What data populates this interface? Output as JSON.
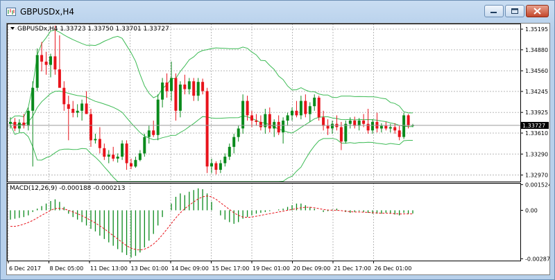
{
  "window": {
    "title": "GBPUSDx,H4"
  },
  "chart_header": {
    "text": "GBPUSDx,H4  1.33723 1.33750 1.33701 1.33727"
  },
  "macd_header": {
    "text": "MACD(12,26,9) -0.000188 -0.000213"
  },
  "colors": {
    "bull": "#0a8a1c",
    "bear": "#e8131b",
    "band": "#3dbb55",
    "signal": "#e8131b",
    "grid": "#b8b8b8"
  },
  "chart_data": [
    {
      "type": "candlestick",
      "symbol": "GBPUSDx",
      "timeframe": "H4",
      "ohlc_last": {
        "open": 1.33723,
        "high": 1.3375,
        "low": 1.33701,
        "close": 1.33727
      },
      "current_price_label": "1.33727",
      "y_tick_labels": [
        "1.35195",
        "1.34880",
        "1.34560",
        "1.34245",
        "1.33925",
        "1.33610",
        "1.33290",
        "1.32970"
      ],
      "ylim": [
        1.3287,
        1.3528
      ],
      "x_tick_labels": [
        "6 Dec 2017",
        "8 Dec 05:00",
        "11 Dec 13:00",
        "13 Dec 01:00",
        "14 Dec 09:00",
        "15 Dec 17:00",
        "19 Dec 01:00",
        "20 Dec 09:00",
        "21 Dec 17:00",
        "26 Dec 01:00"
      ],
      "grid": true,
      "indicator": "Bollinger Bands",
      "candles": [
        {
          "o": 1.3375,
          "h": 1.3385,
          "l": 1.3368,
          "c": 1.3378
        },
        {
          "o": 1.3378,
          "h": 1.3384,
          "l": 1.3364,
          "c": 1.3368
        },
        {
          "o": 1.3368,
          "h": 1.3382,
          "l": 1.3362,
          "c": 1.3377
        },
        {
          "o": 1.3377,
          "h": 1.339,
          "l": 1.3368,
          "c": 1.3372
        },
        {
          "o": 1.3372,
          "h": 1.34,
          "l": 1.3365,
          "c": 1.3395
        },
        {
          "o": 1.3395,
          "h": 1.344,
          "l": 1.331,
          "c": 1.343
        },
        {
          "o": 1.343,
          "h": 1.349,
          "l": 1.3425,
          "c": 1.348
        },
        {
          "o": 1.348,
          "h": 1.35,
          "l": 1.3455,
          "c": 1.347
        },
        {
          "o": 1.347,
          "h": 1.3485,
          "l": 1.345,
          "c": 1.3465
        },
        {
          "o": 1.3465,
          "h": 1.3482,
          "l": 1.3446,
          "c": 1.3478
        },
        {
          "o": 1.3478,
          "h": 1.3525,
          "l": 1.345,
          "c": 1.3458
        },
        {
          "o": 1.3458,
          "h": 1.351,
          "l": 1.344,
          "c": 1.343
        },
        {
          "o": 1.343,
          "h": 1.344,
          "l": 1.3395,
          "c": 1.3405
        },
        {
          "o": 1.3405,
          "h": 1.3418,
          "l": 1.335,
          "c": 1.3398
        },
        {
          "o": 1.3398,
          "h": 1.341,
          "l": 1.3385,
          "c": 1.3392
        },
        {
          "o": 1.3392,
          "h": 1.3405,
          "l": 1.3385,
          "c": 1.3395
        },
        {
          "o": 1.3395,
          "h": 1.3412,
          "l": 1.338,
          "c": 1.3406
        },
        {
          "o": 1.3406,
          "h": 1.3425,
          "l": 1.3395,
          "c": 1.339
        },
        {
          "o": 1.339,
          "h": 1.3398,
          "l": 1.334,
          "c": 1.335
        },
        {
          "o": 1.335,
          "h": 1.336,
          "l": 1.3345,
          "c": 1.3352
        },
        {
          "o": 1.3352,
          "h": 1.337,
          "l": 1.333,
          "c": 1.3338
        },
        {
          "o": 1.3338,
          "h": 1.3345,
          "l": 1.332,
          "c": 1.3325
        },
        {
          "o": 1.3325,
          "h": 1.3335,
          "l": 1.3315,
          "c": 1.3328
        },
        {
          "o": 1.3328,
          "h": 1.334,
          "l": 1.3318,
          "c": 1.3322
        },
        {
          "o": 1.3322,
          "h": 1.333,
          "l": 1.3316,
          "c": 1.3325
        },
        {
          "o": 1.3325,
          "h": 1.335,
          "l": 1.332,
          "c": 1.3345
        },
        {
          "o": 1.3345,
          "h": 1.335,
          "l": 1.3305,
          "c": 1.3315
        },
        {
          "o": 1.3315,
          "h": 1.3322,
          "l": 1.3306,
          "c": 1.331
        },
        {
          "o": 1.331,
          "h": 1.3325,
          "l": 1.3308,
          "c": 1.332
        },
        {
          "o": 1.332,
          "h": 1.3335,
          "l": 1.3318,
          "c": 1.333
        },
        {
          "o": 1.333,
          "h": 1.336,
          "l": 1.3325,
          "c": 1.3355
        },
        {
          "o": 1.3355,
          "h": 1.3372,
          "l": 1.3345,
          "c": 1.3365
        },
        {
          "o": 1.3365,
          "h": 1.338,
          "l": 1.3355,
          "c": 1.3358
        },
        {
          "o": 1.3358,
          "h": 1.342,
          "l": 1.335,
          "c": 1.3412
        },
        {
          "o": 1.3412,
          "h": 1.3445,
          "l": 1.34,
          "c": 1.3438
        },
        {
          "o": 1.3438,
          "h": 1.3452,
          "l": 1.3415,
          "c": 1.3425
        },
        {
          "o": 1.3425,
          "h": 1.347,
          "l": 1.341,
          "c": 1.3445
        },
        {
          "o": 1.3445,
          "h": 1.3452,
          "l": 1.338,
          "c": 1.3395
        },
        {
          "o": 1.3395,
          "h": 1.344,
          "l": 1.3385,
          "c": 1.3435
        },
        {
          "o": 1.3435,
          "h": 1.345,
          "l": 1.342,
          "c": 1.3428
        },
        {
          "o": 1.3428,
          "h": 1.3445,
          "l": 1.342,
          "c": 1.344
        },
        {
          "o": 1.344,
          "h": 1.3445,
          "l": 1.341,
          "c": 1.3418
        },
        {
          "o": 1.3418,
          "h": 1.3445,
          "l": 1.341,
          "c": 1.3439
        },
        {
          "o": 1.3439,
          "h": 1.3444,
          "l": 1.342,
          "c": 1.3425
        },
        {
          "o": 1.3425,
          "h": 1.343,
          "l": 1.33,
          "c": 1.331
        },
        {
          "o": 1.331,
          "h": 1.3322,
          "l": 1.33,
          "c": 1.3315
        },
        {
          "o": 1.3315,
          "h": 1.3318,
          "l": 1.3298,
          "c": 1.3305
        },
        {
          "o": 1.3305,
          "h": 1.332,
          "l": 1.33,
          "c": 1.3315
        },
        {
          "o": 1.3315,
          "h": 1.333,
          "l": 1.331,
          "c": 1.3325
        },
        {
          "o": 1.3325,
          "h": 1.3345,
          "l": 1.332,
          "c": 1.334
        },
        {
          "o": 1.334,
          "h": 1.336,
          "l": 1.333,
          "c": 1.3355
        },
        {
          "o": 1.3355,
          "h": 1.3372,
          "l": 1.3348,
          "c": 1.3368
        },
        {
          "o": 1.3368,
          "h": 1.342,
          "l": 1.336,
          "c": 1.341
        },
        {
          "o": 1.341,
          "h": 1.3418,
          "l": 1.338,
          "c": 1.3388
        },
        {
          "o": 1.3388,
          "h": 1.3395,
          "l": 1.337,
          "c": 1.338
        },
        {
          "o": 1.338,
          "h": 1.339,
          "l": 1.3372,
          "c": 1.3378
        },
        {
          "o": 1.3378,
          "h": 1.3388,
          "l": 1.3365,
          "c": 1.337
        },
        {
          "o": 1.337,
          "h": 1.3398,
          "l": 1.336,
          "c": 1.339
        },
        {
          "o": 1.339,
          "h": 1.34,
          "l": 1.3362,
          "c": 1.3368
        },
        {
          "o": 1.3368,
          "h": 1.3382,
          "l": 1.3355,
          "c": 1.3378
        },
        {
          "o": 1.3378,
          "h": 1.3388,
          "l": 1.3358,
          "c": 1.3362
        },
        {
          "o": 1.3362,
          "h": 1.3385,
          "l": 1.3345,
          "c": 1.338
        },
        {
          "o": 1.338,
          "h": 1.3392,
          "l": 1.3372,
          "c": 1.3388
        },
        {
          "o": 1.3388,
          "h": 1.34,
          "l": 1.338,
          "c": 1.3395
        },
        {
          "o": 1.3395,
          "h": 1.341,
          "l": 1.3385,
          "c": 1.3388
        },
        {
          "o": 1.3388,
          "h": 1.3418,
          "l": 1.3382,
          "c": 1.341
        },
        {
          "o": 1.341,
          "h": 1.342,
          "l": 1.3385,
          "c": 1.339
        },
        {
          "o": 1.339,
          "h": 1.3408,
          "l": 1.3378,
          "c": 1.3402
        },
        {
          "o": 1.3402,
          "h": 1.342,
          "l": 1.3395,
          "c": 1.3415
        },
        {
          "o": 1.3415,
          "h": 1.3418,
          "l": 1.338,
          "c": 1.3385
        },
        {
          "o": 1.3385,
          "h": 1.3395,
          "l": 1.3365,
          "c": 1.3372
        },
        {
          "o": 1.3372,
          "h": 1.3382,
          "l": 1.3358,
          "c": 1.3368
        },
        {
          "o": 1.3368,
          "h": 1.338,
          "l": 1.336,
          "c": 1.3375
        },
        {
          "o": 1.3375,
          "h": 1.3388,
          "l": 1.3365,
          "c": 1.337
        },
        {
          "o": 1.337,
          "h": 1.3378,
          "l": 1.3335,
          "c": 1.3348
        },
        {
          "o": 1.3348,
          "h": 1.338,
          "l": 1.3345,
          "c": 1.3375
        },
        {
          "o": 1.3375,
          "h": 1.3385,
          "l": 1.3368,
          "c": 1.338
        },
        {
          "o": 1.338,
          "h": 1.3386,
          "l": 1.3368,
          "c": 1.3372
        },
        {
          "o": 1.3372,
          "h": 1.3384,
          "l": 1.3365,
          "c": 1.338
        },
        {
          "o": 1.338,
          "h": 1.339,
          "l": 1.337,
          "c": 1.3375
        },
        {
          "o": 1.3375,
          "h": 1.3398,
          "l": 1.336,
          "c": 1.3365
        },
        {
          "o": 1.3365,
          "h": 1.3382,
          "l": 1.336,
          "c": 1.3378
        },
        {
          "o": 1.3378,
          "h": 1.3392,
          "l": 1.3362,
          "c": 1.3368
        },
        {
          "o": 1.3368,
          "h": 1.3376,
          "l": 1.3362,
          "c": 1.3372
        },
        {
          "o": 1.3372,
          "h": 1.3378,
          "l": 1.3365,
          "c": 1.3368
        },
        {
          "o": 1.3368,
          "h": 1.3375,
          "l": 1.3362,
          "c": 1.337
        },
        {
          "o": 1.337,
          "h": 1.3376,
          "l": 1.336,
          "c": 1.3365
        },
        {
          "o": 1.3365,
          "h": 1.3372,
          "l": 1.335,
          "c": 1.3355
        },
        {
          "o": 1.3355,
          "h": 1.3392,
          "l": 1.3352,
          "c": 1.3388
        },
        {
          "o": 1.3388,
          "h": 1.339,
          "l": 1.3368,
          "c": 1.3372
        },
        {
          "o": 1.3372,
          "h": 1.3375,
          "l": 1.337,
          "c": 1.33727
        }
      ]
    },
    {
      "type": "bar",
      "indicator": "MACD(12,26,9)",
      "main": -0.000188,
      "signal": -0.000213,
      "y_tick_labels": [
        "0.001524",
        "0.00",
        "-0.00287"
      ],
      "ylim": [
        -0.00298,
        0.00162
      ],
      "histogram": [
        -0.00055,
        -0.0005,
        -0.00045,
        -0.0004,
        -0.0003,
        -0.0001,
        0.0001,
        0.00025,
        0.0004,
        0.00055,
        0.00065,
        0.0005,
        0.0002,
        -0.0002,
        -0.0004,
        -0.00055,
        -0.0007,
        -0.0009,
        -0.0011,
        -0.00125,
        -0.0015,
        -0.0017,
        -0.0019,
        -0.0021,
        -0.0023,
        -0.0025,
        -0.00265,
        -0.0028,
        -0.0027,
        -0.0025,
        -0.0022,
        -0.0018,
        -0.0014,
        -0.0009,
        -0.0004,
        0.0,
        0.0004,
        0.0008,
        0.001,
        0.0009,
        0.0011,
        0.0012,
        0.0013,
        0.00125,
        0.001,
        0.0005,
        0.0,
        -0.0003,
        -0.00055,
        -0.0007,
        -0.0008,
        -0.0007,
        -0.0005,
        -0.0004,
        -0.0003,
        -0.0002,
        -0.00015,
        -0.0001,
        -5e-05,
        0.0,
        5e-05,
        0.0001,
        0.0002,
        0.0003,
        0.0004,
        0.0004,
        0.0003,
        0.0002,
        0.0001,
        0.0,
        -0.0001,
        -5e-05,
        5e-05,
        0.0001,
        0.0,
        -0.0001,
        -0.00015,
        -0.0001,
        -5e-05,
        -0.0001,
        -0.00015,
        -0.0002,
        -0.0002,
        -0.0002,
        -0.00015,
        -0.0002,
        -0.00025,
        -0.0003,
        -0.00015,
        -0.0002,
        -0.00019
      ],
      "signal_line": [
        -0.00095,
        -0.00095,
        -0.0009,
        -0.00082,
        -0.00072,
        -0.0006,
        -0.00045,
        -0.0003,
        -0.00015,
        0.0,
        0.0001,
        0.00012,
        8e-05,
        0.0,
        -0.0001,
        -0.0002,
        -0.00032,
        -0.00045,
        -0.0006,
        -0.00075,
        -0.00092,
        -0.0011,
        -0.0013,
        -0.0015,
        -0.0017,
        -0.0019,
        -0.0021,
        -0.00225,
        -0.00232,
        -0.00235,
        -0.0023,
        -0.00218,
        -0.002,
        -0.00175,
        -0.00145,
        -0.00112,
        -0.00078,
        -0.00045,
        -0.00015,
        0.0001,
        0.0003,
        0.0005,
        0.00068,
        0.0008,
        0.00085,
        0.0008,
        0.00065,
        0.00045,
        0.00025,
        5e-05,
        -0.00015,
        -0.0003,
        -0.0004,
        -0.00042,
        -0.0004,
        -0.00035,
        -0.0003,
        -0.00025,
        -0.0002,
        -0.00015,
        -0.0001,
        -5e-05,
        0.0,
        5e-05,
        0.0001,
        0.00015,
        0.00018,
        0.00018,
        0.00015,
        0.0001,
        5e-05,
        2e-05,
        0.0,
        0.0,
        -2e-05,
        -5e-05,
        -8e-05,
        -0.0001,
        -0.0001,
        -0.00011,
        -0.00012,
        -0.00014,
        -0.00016,
        -0.00017,
        -0.00017,
        -0.00018,
        -0.0002,
        -0.00022,
        -0.00021,
        -0.00021,
        -0.00021
      ]
    }
  ]
}
